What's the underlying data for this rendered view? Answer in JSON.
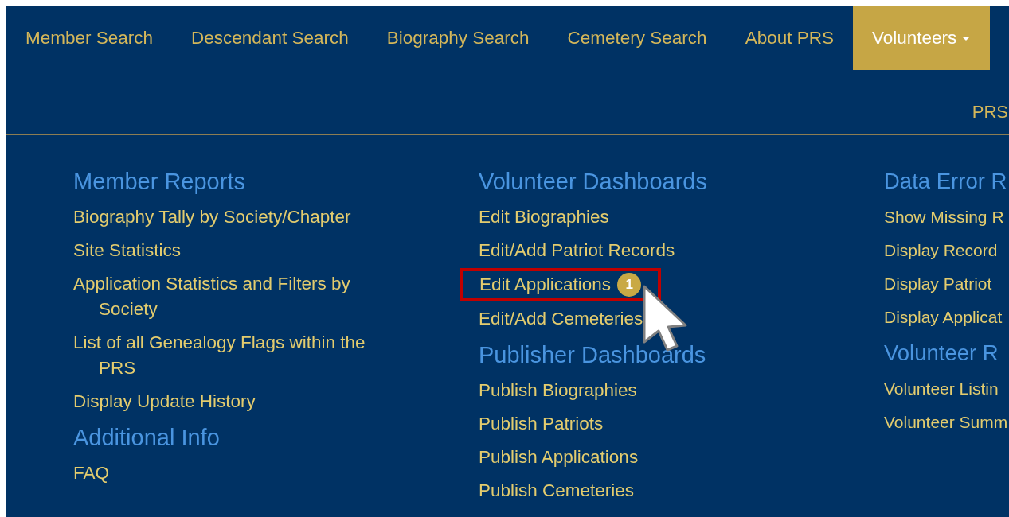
{
  "nav": [
    {
      "label": "Member Search",
      "selected": false,
      "dropdown": false
    },
    {
      "label": "Descendant Search",
      "selected": false,
      "dropdown": false
    },
    {
      "label": "Biography Search",
      "selected": false,
      "dropdown": false
    },
    {
      "label": "Cemetery Search",
      "selected": false,
      "dropdown": false
    },
    {
      "label": "About PRS",
      "selected": false,
      "dropdown": false
    },
    {
      "label": "Volunteers",
      "selected": true,
      "dropdown": true
    }
  ],
  "subnav": "PRS",
  "columns": [
    {
      "sections": [
        {
          "heading": "Member Reports",
          "links": [
            {
              "label": "Biography Tally by Society/Chapter",
              "highlighted": false
            },
            {
              "label": "Site Statistics",
              "highlighted": false
            },
            {
              "label": "Application Statistics and Filters by Society",
              "highlighted": false
            },
            {
              "label": "List of all Genealogy Flags within the PRS",
              "highlighted": false
            },
            {
              "label": "Display Update History",
              "highlighted": false
            }
          ]
        },
        {
          "heading": "Additional Info",
          "links": [
            {
              "label": "FAQ",
              "highlighted": false
            }
          ]
        }
      ]
    },
    {
      "sections": [
        {
          "heading": "Volunteer Dashboards",
          "links": [
            {
              "label": "Edit Biographies",
              "highlighted": false
            },
            {
              "label": "Edit/Add Patriot Records",
              "highlighted": false
            },
            {
              "label": "Edit Applications",
              "badge": "1",
              "highlighted": true
            },
            {
              "label": "Edit/Add Cemeteries",
              "highlighted": false
            }
          ]
        },
        {
          "heading": "Publisher Dashboards",
          "links": [
            {
              "label": "Publish Biographies",
              "highlighted": false
            },
            {
              "label": "Publish Patriots",
              "highlighted": false
            },
            {
              "label": "Publish Applications",
              "highlighted": false
            },
            {
              "label": "Publish Cemeteries",
              "highlighted": false
            }
          ]
        }
      ]
    },
    {
      "sections": [
        {
          "heading": "Data Error R",
          "links": [
            {
              "label": "Show Missing R",
              "highlighted": false
            },
            {
              "label": "Display Record",
              "highlighted": false
            },
            {
              "label": "Display Patriot",
              "highlighted": false
            },
            {
              "label": "Display Applicat",
              "highlighted": false
            }
          ]
        },
        {
          "heading": "Volunteer R",
          "links": [
            {
              "label": "Volunteer Listin",
              "highlighted": false
            },
            {
              "label": "Volunteer Summ",
              "highlighted": false
            }
          ]
        }
      ]
    }
  ]
}
